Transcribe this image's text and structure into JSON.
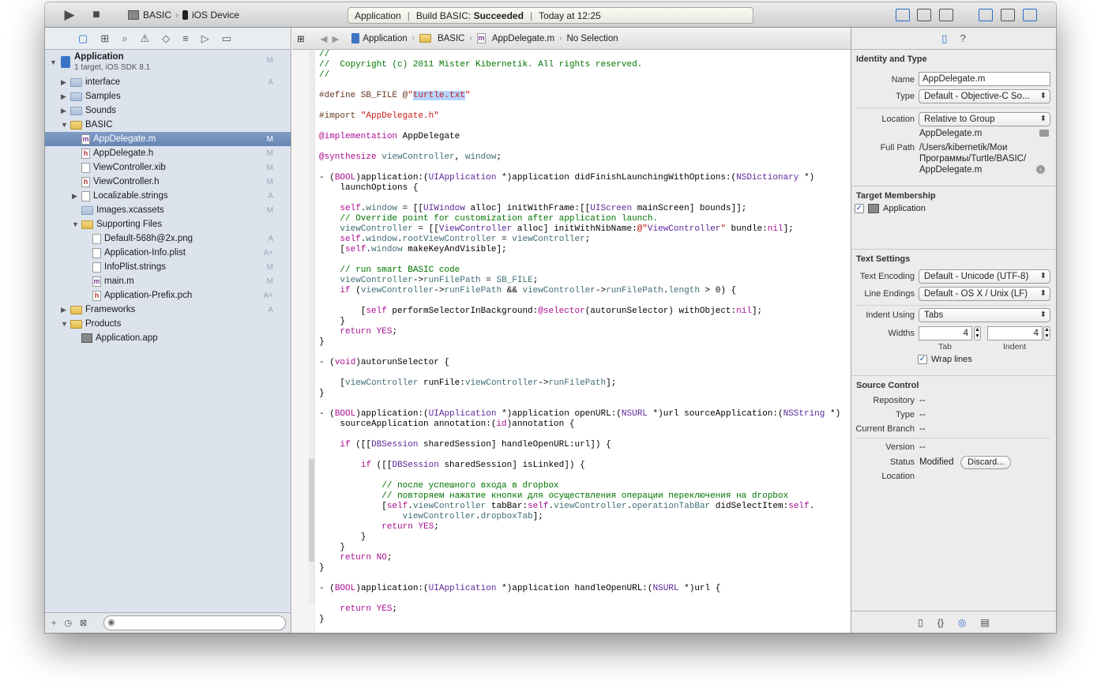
{
  "toolbar": {
    "run_label": "▶",
    "stop_label": "■",
    "scheme_target": "BASIC",
    "scheme_device": "iOS Device",
    "status_app": "Application",
    "status_build_prefix": "Build BASIC:",
    "status_build_result": "Succeeded",
    "status_time": "Today at 12:25"
  },
  "navigator": {
    "project": {
      "name": "Application",
      "subtitle": "1 target, iOS SDK 8.1",
      "badge": "M"
    },
    "items": [
      {
        "label": "interface",
        "badge": "A",
        "kind": "folder"
      },
      {
        "label": "Samples",
        "badge": "",
        "kind": "folder"
      },
      {
        "label": "Sounds",
        "badge": "",
        "kind": "folder"
      },
      {
        "label": "BASIC",
        "badge": "",
        "kind": "yfolder"
      },
      {
        "label": "AppDelegate.m",
        "badge": "M",
        "kind": "m"
      },
      {
        "label": "AppDelegate.h",
        "badge": "M",
        "kind": "h"
      },
      {
        "label": "ViewController.xib",
        "badge": "M",
        "kind": "xib"
      },
      {
        "label": "ViewController.h",
        "badge": "M",
        "kind": "h"
      },
      {
        "label": "Localizable.strings",
        "badge": "A",
        "kind": "file"
      },
      {
        "label": "Images.xcassets",
        "badge": "M",
        "kind": "folder"
      },
      {
        "label": "Supporting Files",
        "badge": "",
        "kind": "yfolder"
      },
      {
        "label": "Default-568h@2x.png",
        "badge": "A",
        "kind": "file"
      },
      {
        "label": "Application-Info.plist",
        "badge": "A+",
        "kind": "file"
      },
      {
        "label": "InfoPlist.strings",
        "badge": "M",
        "kind": "file"
      },
      {
        "label": "main.m",
        "badge": "M",
        "kind": "m"
      },
      {
        "label": "Application-Prefix.pch",
        "badge": "A+",
        "kind": "h"
      },
      {
        "label": "Frameworks",
        "badge": "A",
        "kind": "yfolder"
      },
      {
        "label": "Products",
        "badge": "",
        "kind": "yfolder"
      },
      {
        "label": "Application.app",
        "badge": "",
        "kind": "app"
      }
    ]
  },
  "jumpbar": {
    "crumbs": [
      "Application",
      "BASIC",
      "AppDelegate.m",
      "No Selection"
    ]
  },
  "code": {
    "lines": [
      "//",
      "//  Copyright (c) 2011 Mister Kibernetik. All rights reserved.",
      "//",
      "",
      "#define SB_FILE @\"turtle.txt\"",
      "",
      "#import \"AppDelegate.h\"",
      "",
      "@implementation AppDelegate",
      "",
      "@synthesize viewController, window;",
      "",
      "- (BOOL)application:(UIApplication *)application didFinishLaunchingWithOptions:(NSDictionary *)",
      "    launchOptions {",
      "",
      "    self.window = [[UIWindow alloc] initWithFrame:[[UIScreen mainScreen] bounds]];",
      "    // Override point for customization after application launch.",
      "    viewController = [[ViewController alloc] initWithNibName:@\"ViewController\" bundle:nil];",
      "    self.window.rootViewController = viewController;",
      "    [self.window makeKeyAndVisible];",
      "",
      "    // run smart BASIC code",
      "    viewController->runFilePath = SB_FILE;",
      "    if (viewController->runFilePath && viewController->runFilePath.length > 0) {",
      "",
      "        [self performSelectorInBackground:@selector(autorunSelector) withObject:nil];",
      "    }",
      "    return YES;",
      "}",
      "",
      "- (void)autorunSelector {",
      "",
      "    [viewController runFile:viewController->runFilePath];",
      "}",
      "",
      "- (BOOL)application:(UIApplication *)application openURL:(NSURL *)url sourceApplication:(NSString *)",
      "    sourceApplication annotation:(id)annotation {",
      "",
      "    if ([[DBSession sharedSession] handleOpenURL:url]) {",
      "",
      "        if ([[DBSession sharedSession] isLinked]) {",
      "",
      "            // после успешного входа в dropbox",
      "            // повторяем нажатие кнопки для осуществления операции переключения на dropbox",
      "            [self.viewController tabBar:self.viewController.operationTabBar didSelectItem:self.",
      "                viewController.dropboxTab];",
      "            return YES;",
      "        }",
      "    }",
      "    return NO;",
      "}",
      "",
      "- (BOOL)application:(UIApplication *)application handleOpenURL:(NSURL *)url {",
      "",
      "    return YES;",
      "}"
    ]
  },
  "inspector": {
    "identity": {
      "title": "Identity and Type",
      "name_label": "Name",
      "name_value": "AppDelegate.m",
      "type_label": "Type",
      "type_value": "Default - Objective-C So...",
      "location_label": "Location",
      "location_value": "Relative to Group",
      "location_path": "AppDelegate.m",
      "fullpath_label": "Full Path",
      "fullpath_value_1": "/Users/kibernetik/Мои",
      "fullpath_value_2": "Программы/Turtle/BASIC/",
      "fullpath_value_3": "AppDelegate.m"
    },
    "target": {
      "title": "Target Membership",
      "item": "Application"
    },
    "text": {
      "title": "Text Settings",
      "encoding_label": "Text Encoding",
      "encoding_value": "Default - Unicode (UTF-8)",
      "endings_label": "Line Endings",
      "endings_value": "Default - OS X / Unix (LF)",
      "indent_label": "Indent Using",
      "indent_value": "Tabs",
      "widths_label": "Widths",
      "tab_value": "4",
      "indent_width_value": "4",
      "tab_caption": "Tab",
      "indent_caption": "Indent",
      "wrap_label": "Wrap lines"
    },
    "source": {
      "title": "Source Control",
      "repository_label": "Repository",
      "repository_value": "--",
      "type_label": "Type",
      "type_value": "--",
      "branch_label": "Current Branch",
      "branch_value": "--",
      "version_label": "Version",
      "version_value": "--",
      "status_label": "Status",
      "status_value": "Modified",
      "discard_label": "Discard...",
      "location_label": "Location"
    }
  }
}
